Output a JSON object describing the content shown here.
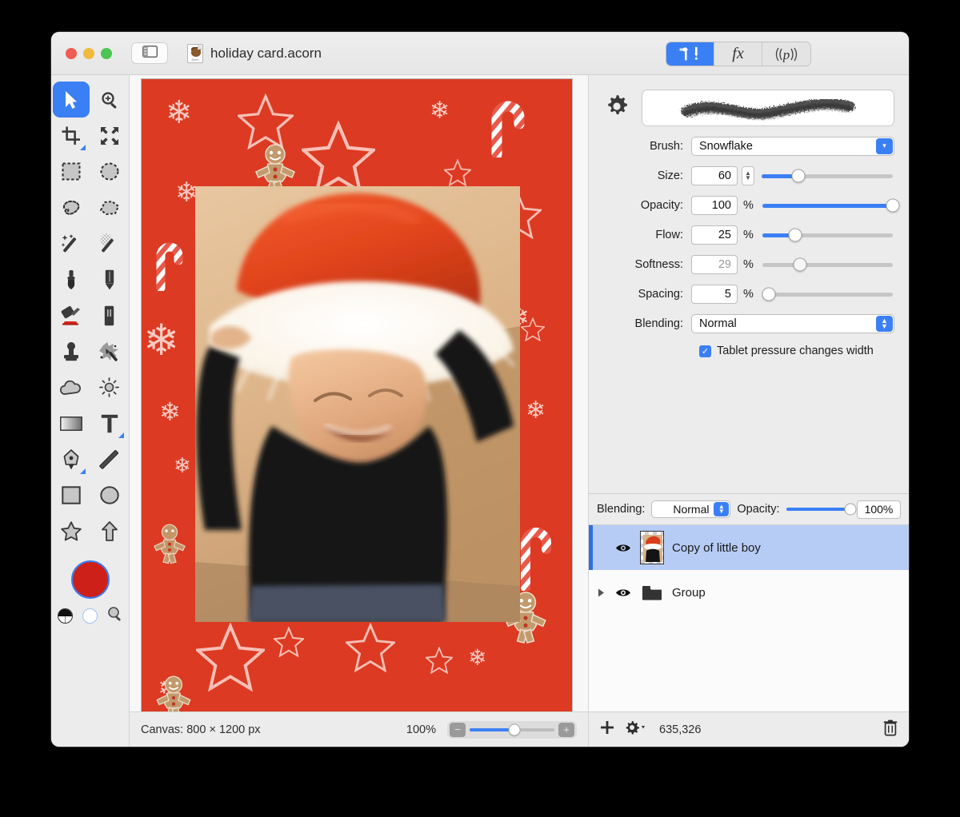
{
  "window": {
    "title": "holiday card.acorn",
    "traffic_lights": [
      "close",
      "minimize",
      "zoom"
    ],
    "sidebar_toggle_icon": "sidebar-icon",
    "doc_icon": "acorn-document-icon",
    "doc_icon_label": "Acorn"
  },
  "inspector_tabs": [
    {
      "id": "tools",
      "icon": "hammer-pen-icon",
      "label": "",
      "active": true
    },
    {
      "id": "filters",
      "icon": "fx-icon",
      "label": "fx",
      "active": false
    },
    {
      "id": "presets",
      "icon": "p-icon",
      "label": "p",
      "active": false
    }
  ],
  "tools": [
    {
      "name": "move-tool",
      "icon": "arrow-cursor-icon",
      "selected": true,
      "corner": false
    },
    {
      "name": "zoom-tool",
      "icon": "magnifier-plus-icon",
      "selected": false,
      "corner": false
    },
    {
      "name": "crop-tool",
      "icon": "crop-icon",
      "selected": false,
      "corner": true
    },
    {
      "name": "transform-tool",
      "icon": "arrows-four-way-icon",
      "selected": false,
      "corner": false
    },
    {
      "name": "rectangular-select-tool",
      "icon": "dashed-rectangle-icon",
      "selected": false,
      "corner": false
    },
    {
      "name": "elliptical-select-tool",
      "icon": "dashed-ellipse-icon",
      "selected": false,
      "corner": false
    },
    {
      "name": "lasso-tool",
      "icon": "lasso-icon",
      "selected": false,
      "corner": false
    },
    {
      "name": "polygon-lasso-tool",
      "icon": "polygon-lasso-icon",
      "selected": false,
      "corner": false
    },
    {
      "name": "magic-wand-tool",
      "icon": "magic-wand-icon",
      "selected": false,
      "corner": false
    },
    {
      "name": "instant-alpha-tool",
      "icon": "instant-alpha-wand-icon",
      "selected": false,
      "corner": false
    },
    {
      "name": "brush-tool",
      "icon": "paintbrush-icon",
      "selected": false,
      "corner": false
    },
    {
      "name": "pencil-tool",
      "icon": "pencil-icon",
      "selected": false,
      "corner": false
    },
    {
      "name": "paint-bucket-tool",
      "icon": "paint-bucket-icon",
      "selected": false,
      "corner": false
    },
    {
      "name": "eraser-tool",
      "icon": "eraser-icon",
      "selected": false,
      "corner": false
    },
    {
      "name": "clone-stamp-tool",
      "icon": "clone-stamp-icon",
      "selected": false,
      "corner": false
    },
    {
      "name": "smudge-tool",
      "icon": "smudge-splat-icon",
      "selected": false,
      "corner": false
    },
    {
      "name": "blur-tool",
      "icon": "cloud-blur-icon",
      "selected": false,
      "corner": false
    },
    {
      "name": "dodge-tool",
      "icon": "sun-dodge-icon",
      "selected": false,
      "corner": false
    },
    {
      "name": "gradient-tool",
      "icon": "gradient-icon",
      "selected": false,
      "corner": false
    },
    {
      "name": "text-tool",
      "icon": "text-t-icon",
      "selected": false,
      "corner": true
    },
    {
      "name": "bezier-tool",
      "icon": "pen-nib-icon",
      "selected": false,
      "corner": true
    },
    {
      "name": "line-tool",
      "icon": "line-icon",
      "selected": false,
      "corner": false
    },
    {
      "name": "rectangle-shape-tool",
      "icon": "rectangle-icon",
      "selected": false,
      "corner": false
    },
    {
      "name": "ellipse-shape-tool",
      "icon": "ellipse-icon",
      "selected": false,
      "corner": false
    },
    {
      "name": "star-shape-tool",
      "icon": "star-icon",
      "selected": false,
      "corner": false
    },
    {
      "name": "arrow-shape-tool",
      "icon": "up-arrow-icon",
      "selected": false,
      "corner": false
    }
  ],
  "color_well": {
    "foreground": "#cc2018",
    "selected": true,
    "mini": [
      {
        "name": "black-white-swatch",
        "icon": "yin-yang-bw-icon"
      },
      {
        "name": "white-swatch",
        "icon": "white-circle-icon"
      },
      {
        "name": "color-picker-swatch",
        "icon": "magnifier-icon"
      }
    ]
  },
  "brush_panel": {
    "gear_icon": "gear-icon",
    "preview_name": "brush-stroke-preview",
    "brush": {
      "label": "Brush:",
      "value": "Snowflake"
    },
    "size": {
      "label": "Size:",
      "value": "60",
      "unit": "",
      "slider_pct": 28,
      "disabled": false
    },
    "opacity": {
      "label": "Opacity:",
      "value": "100",
      "unit": "%",
      "slider_pct": 100,
      "disabled": false
    },
    "flow": {
      "label": "Flow:",
      "value": "25",
      "unit": "%",
      "slider_pct": 25,
      "disabled": false
    },
    "softness": {
      "label": "Softness:",
      "value": "29",
      "unit": "%",
      "slider_pct": 29,
      "disabled": true
    },
    "spacing": {
      "label": "Spacing:",
      "value": "5",
      "unit": "%",
      "slider_pct": 5,
      "disabled": false
    },
    "blending": {
      "label": "Blending:",
      "value": "Normal"
    },
    "tablet_pressure": {
      "label": "Tablet pressure changes width",
      "checked": true
    }
  },
  "layers_panel": {
    "blending_label": "Blending:",
    "blending_value": "Normal",
    "opacity_label": "Opacity:",
    "opacity_value": "100%",
    "opacity_pct": 100,
    "rows": [
      {
        "name": "Copy of little boy",
        "selected": true,
        "visible": true,
        "kind": "image",
        "has_disclosure": false
      },
      {
        "name": "Group",
        "selected": false,
        "visible": true,
        "kind": "group",
        "has_disclosure": true
      }
    ],
    "footer": {
      "add_icon": "plus-icon",
      "settings_icon": "gear-dropdown-icon",
      "pixel_count": "635,326",
      "delete_icon": "trash-icon"
    }
  },
  "status_bar": {
    "canvas_text": "Canvas: 800 × 1200 px",
    "zoom_text": "100%",
    "zoom_out_icon": "minus-magnifier-icon",
    "zoom_in_icon": "plus-magnifier-icon",
    "zoom_slider_pct": 53
  },
  "canvas": {
    "background_color": "#dc3a22",
    "photo_alt": "toddler wearing a red santa hat with white fur trim, smiling downward"
  },
  "colors": {
    "accent": "#3b7ff5",
    "card_red": "#dc3a22",
    "swatch_red": "#cc2018",
    "selection_blue": "#b7ccf5",
    "chrome": "#ececec"
  }
}
